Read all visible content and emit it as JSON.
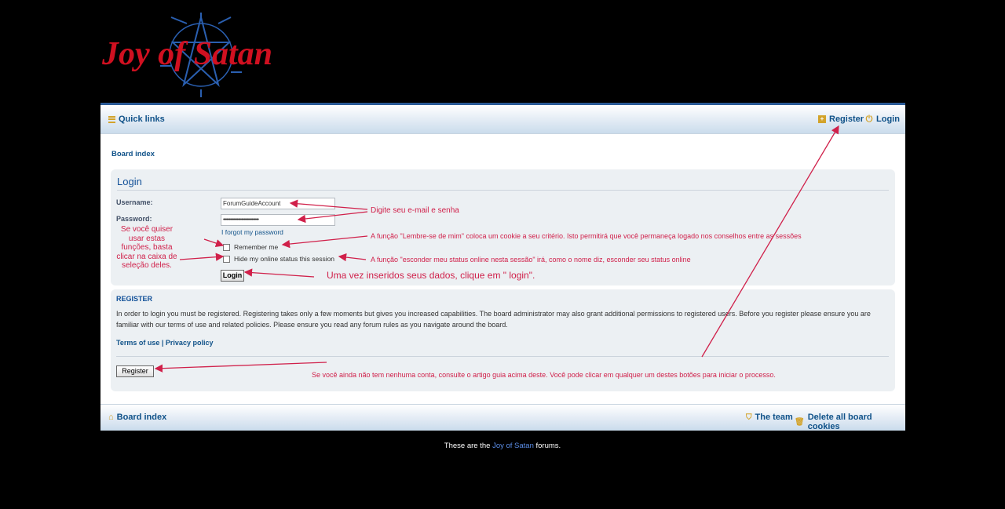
{
  "logo": {
    "text": "Joy of Satan"
  },
  "navbar": {
    "quick_links": "Quick links",
    "register": "Register",
    "login": "Login"
  },
  "breadcrumb": "Board index",
  "login_panel": {
    "title": "Login",
    "username_label": "Username:",
    "username_value": "ForumGuideAccount",
    "password_label": "Password:",
    "password_value": "•••••••••••••••••••••••••••••••",
    "forgot_password": "I forgot my password",
    "remember_me": "Remember me",
    "hide_status": "Hide my online status this session",
    "login_button": "Login"
  },
  "register_panel": {
    "title": "REGISTER",
    "text": "In order to login you must be registered. Registering takes only a few moments but gives you increased capabilities. The board administrator may also grant additional permissions to registered users. Before you register please ensure you are familiar with our terms of use and related policies. Please ensure you read any forum rules as you navigate around the board.",
    "terms": "Terms of use",
    "separator": "|",
    "privacy": "Privacy policy",
    "register_button": "Register"
  },
  "footer": {
    "board_index": "Board index",
    "the_team": "The team",
    "delete_cookies": "Delete all board cookies"
  },
  "copyright": {
    "before": "These are the ",
    "link": "Joy of Satan",
    "after": " forums."
  },
  "annotations": {
    "email": "Digite seu e-mail e senha",
    "remember": "A função \"Lembre-se de mim\" coloca um cookie a seu critério. Isto permitirá que você permaneça logado nos conselhos entre as sessões",
    "hide": "A função \"esconder meu status online nesta sessão\" irá, como o nome diz, esconder seu status online",
    "login": "Uma vez inseridos seus dados, clique em \" login\".",
    "side": "Se você quiser usar estas funções, basta clicar na caixa de seleção deles.",
    "register": "Se você ainda não tem nenhuma conta, consulte o artigo guia acima deste. Você pode clicar em qualquer um destes botões para iniciar o processo."
  },
  "colors": {
    "annotation": "#d0204a",
    "link": "#105289",
    "accent": "#d3a32a",
    "logo_red": "#d01020",
    "logo_blue": "#2a5fb0"
  }
}
